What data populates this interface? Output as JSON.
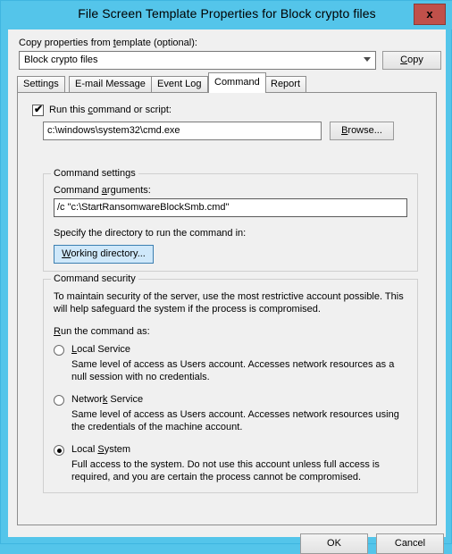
{
  "window": {
    "title": "File Screen Template Properties for Block crypto files",
    "close_label": "x",
    "titlebar_color": "#54c5ea",
    "close_color": "#c0504a"
  },
  "copy_section": {
    "label": "Copy properties from template (optional):",
    "template_value": "Block crypto files",
    "copy_button": "Copy",
    "dropdown_icon": "chevron-down-icon"
  },
  "tabs": [
    {
      "label": "Settings",
      "active": false
    },
    {
      "label": "E-mail Message",
      "active": false
    },
    {
      "label": "Event Log",
      "active": false
    },
    {
      "label": "Command",
      "active": true
    },
    {
      "label": "Report",
      "active": false
    }
  ],
  "command_tab": {
    "run_command_label": "Run this command or script:",
    "run_command_checked": true,
    "check_glyph": "✔",
    "command_value": "c:\\windows\\system32\\cmd.exe",
    "browse_button": "Browse...",
    "command_settings": {
      "group_title": "Command settings",
      "arguments_label": "Command arguments:",
      "arguments_value": "/c \"c:\\StartRansomwareBlockSmb.cmd\"",
      "directory_label": "Specify the directory to run the command in:",
      "working_directory_button": "Working directory...",
      "working_directory_focused": true,
      "focus_color": "#cfe8fa"
    },
    "command_security": {
      "group_title": "Command security",
      "intro": "To maintain security of the server, use the most restrictive account possible. This will help safeguard the system if the process is compromised.",
      "run_as_label": "Run the command as:",
      "options": [
        {
          "label": "Local Service",
          "selected": false,
          "description": "Same level of access as Users account. Accesses network resources as a null session with no credentials."
        },
        {
          "label": "Network Service",
          "selected": false,
          "description": "Same level of access as Users account. Accesses network resources using the credentials of the machine account."
        },
        {
          "label": "Local System",
          "selected": true,
          "description": "Full access to the system. Do not use this account unless full access is required, and you are certain the process cannot be compromised."
        }
      ]
    }
  },
  "footer": {
    "ok": "OK",
    "cancel": "Cancel"
  }
}
